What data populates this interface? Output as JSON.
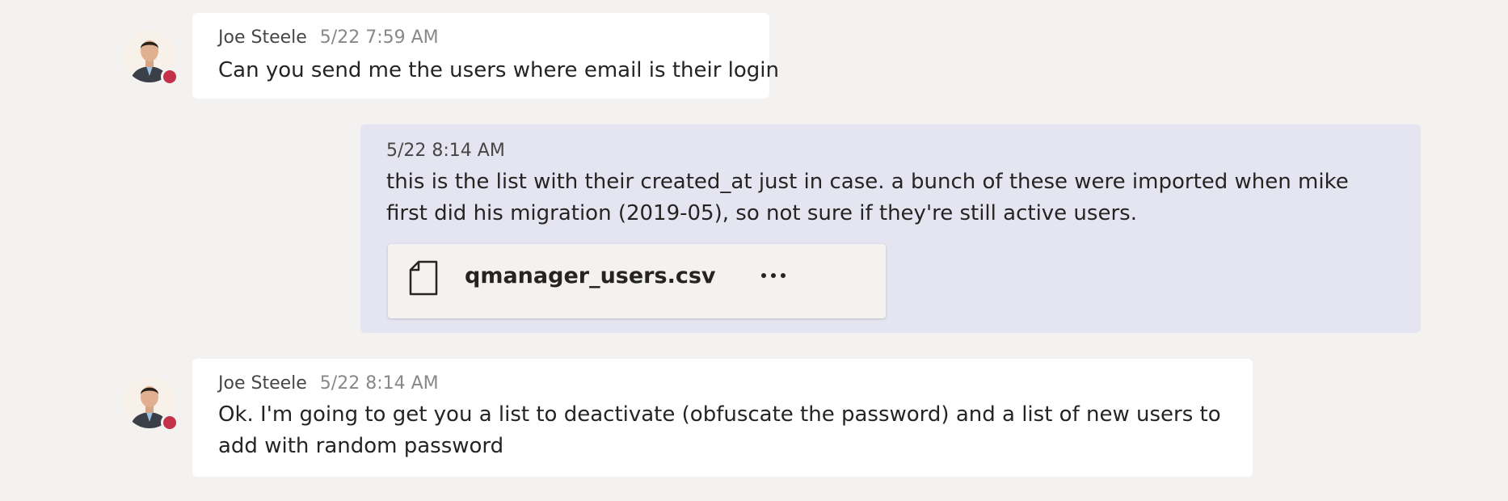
{
  "messages": [
    {
      "author": "Joe Steele",
      "time": "5/22 7:59 AM",
      "text": "Can you send me the users where email is their login",
      "presence": "busy"
    },
    {
      "time": "5/22 8:14 AM",
      "text": "this is the list with their created_at just in case. a bunch of these were imported when mike first did his migration (2019-05), so not sure if they're still active users.",
      "attachment": {
        "name": "qmanager_users.csv",
        "icon": "file-icon",
        "menu_icon": "more-options-icon"
      }
    },
    {
      "author": "Joe Steele",
      "time": "5/22 8:14 AM",
      "text": "Ok. I'm going to get you a list to deactivate (obfuscate the password) and a list of new users to add with random password",
      "presence": "busy"
    }
  ],
  "colors": {
    "background": "#f3f2f1",
    "incoming_bubble": "#ffffff",
    "outgoing_bubble": "#e5e5f1",
    "presence_busy": "#c4314b"
  }
}
